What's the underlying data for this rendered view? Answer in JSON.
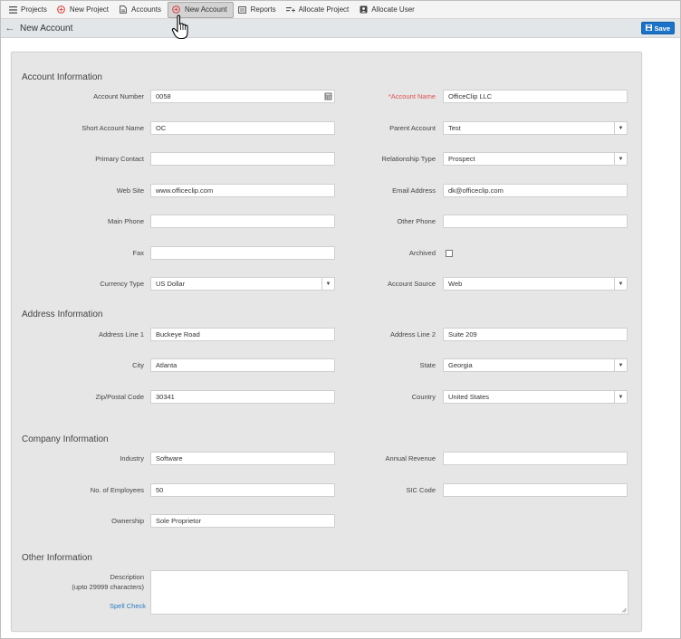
{
  "nav": {
    "items": [
      {
        "label": "Projects"
      },
      {
        "label": "New Project"
      },
      {
        "label": "Accounts"
      },
      {
        "label": "New Account"
      },
      {
        "label": "Reports"
      },
      {
        "label": "Allocate Project"
      },
      {
        "label": "Allocate User"
      }
    ],
    "active_color": "#d3d3d3"
  },
  "titlebar": {
    "title": "New Account",
    "save_label": "Save"
  },
  "colors": {
    "save_button": "#1a73c8",
    "required_label": "#e05050",
    "link": "#2a7ac2"
  },
  "sections": {
    "account": "Account Information",
    "address": "Address Information",
    "company": "Company Information",
    "other": "Other Information"
  },
  "fields": {
    "account_number": {
      "label": "Account Number",
      "value": "0058"
    },
    "account_name": {
      "label": "*Account Name",
      "value": "OfficeClip LLC"
    },
    "short_account_name": {
      "label": "Short Account Name",
      "value": "OC"
    },
    "parent_account": {
      "label": "Parent Account",
      "value": "Test"
    },
    "primary_contact": {
      "label": "Primary Contact",
      "value": ""
    },
    "relationship_type": {
      "label": "Relationship Type",
      "value": "Prospect"
    },
    "web_site": {
      "label": "Web Site",
      "value": "www.officeclip.com"
    },
    "email_address": {
      "label": "Email Address",
      "value": "dk@officeclip.com"
    },
    "main_phone": {
      "label": "Main Phone",
      "value": ""
    },
    "other_phone": {
      "label": "Other Phone",
      "value": ""
    },
    "fax": {
      "label": "Fax",
      "value": ""
    },
    "archived": {
      "label": "Archived",
      "checked": false
    },
    "currency_type": {
      "label": "Currency Type",
      "value": "US Dollar"
    },
    "account_source": {
      "label": "Account Source",
      "value": "Web"
    },
    "address_line_1": {
      "label": "Address Line 1",
      "value": "Buckeye Road"
    },
    "address_line_2": {
      "label": "Address Line 2",
      "value": "Suite 209"
    },
    "city": {
      "label": "City",
      "value": "Atlanta"
    },
    "state": {
      "label": "State",
      "value": "Georgia"
    },
    "zip": {
      "label": "Zip/Postal Code",
      "value": "30341"
    },
    "country": {
      "label": "Country",
      "value": "United States"
    },
    "industry": {
      "label": "Industry",
      "value": "Software"
    },
    "annual_revenue": {
      "label": "Annual Revenue",
      "value": ""
    },
    "employees": {
      "label": "No. of Employees",
      "value": "50"
    },
    "sic_code": {
      "label": "SIC Code",
      "value": ""
    },
    "ownership": {
      "label": "Ownership",
      "value": "Sole Proprietor"
    },
    "description": {
      "label": "Description",
      "sublabel": "(upto 29999 characters)",
      "value": ""
    },
    "spell_check": "Spell Check"
  }
}
